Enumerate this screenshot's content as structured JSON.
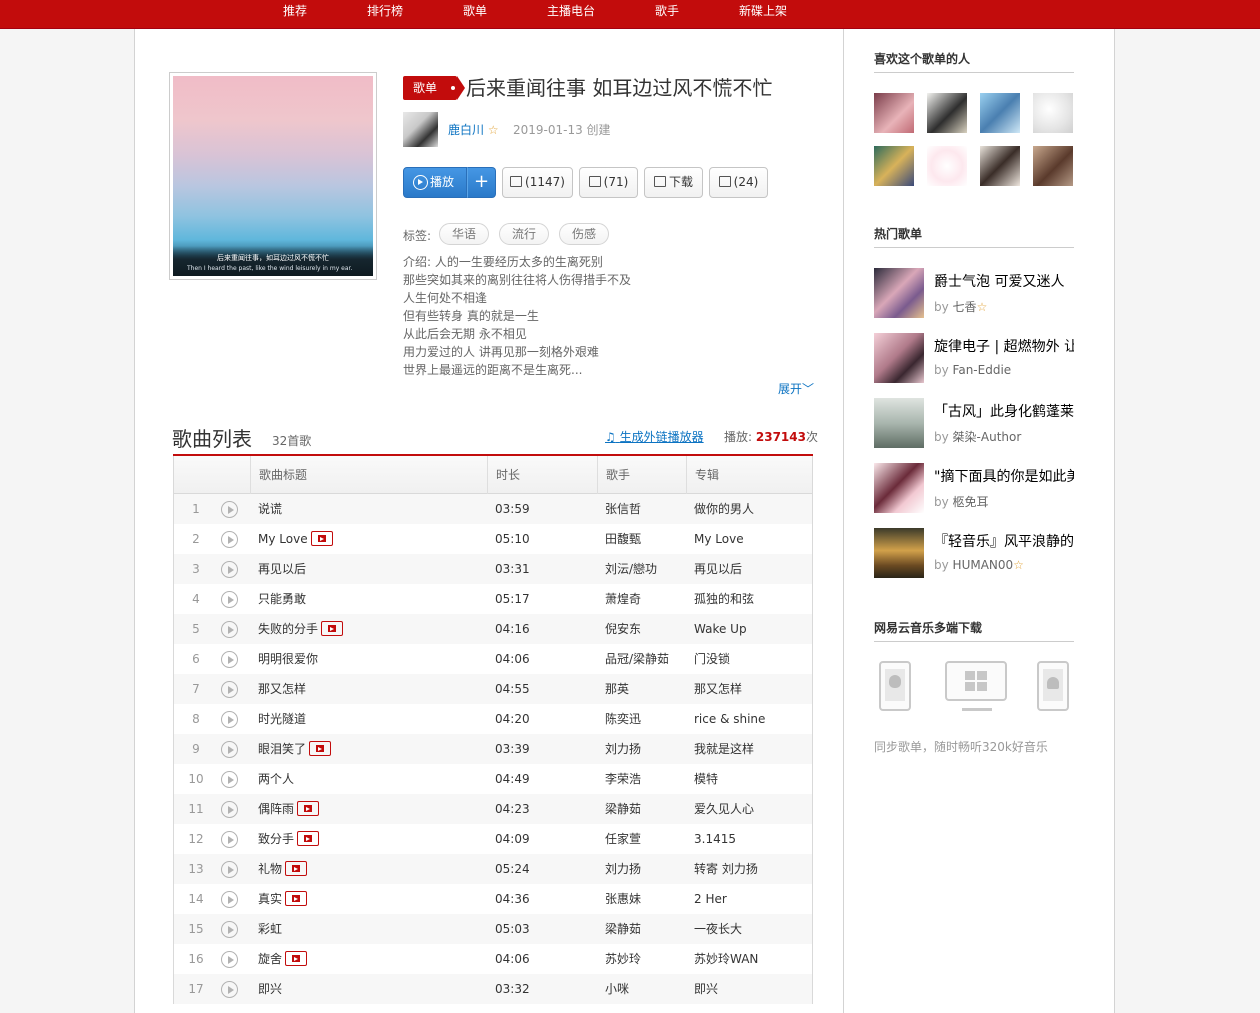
{
  "topnav": [
    "推荐",
    "排行榜",
    "歌单",
    "主播电台",
    "歌手",
    "新碟上架"
  ],
  "playlist": {
    "badge": "歌单",
    "title": "后来重闻往事 如耳边过风不慌不忙",
    "creator": "鹿白川",
    "create_date": "2019-01-13 创建",
    "cover_caption_1": "后来重闻往事，如耳边过风不慌不忙",
    "cover_caption_2": "Then I heard the past, like the wind leisurely in my ear.",
    "buttons": {
      "play": "播放",
      "add": "+",
      "collect": "(1147)",
      "share": "(71)",
      "download": "下载",
      "comment": "(24)"
    },
    "tags_label": "标签:",
    "tags": [
      "华语",
      "流行",
      "伤感"
    ],
    "intro": [
      "介绍:  人的一生要经历太多的生离死别",
      "那些突如其来的离别往往将人伤得措手不及",
      "人生何处不相逢",
      "但有些转身 真的就是一生",
      "从此后会无期 永不相见",
      "用力爱过的人 讲再见那一刻格外艰难",
      "世界上最遥远的距离不是生离死..."
    ],
    "expand_label": "展开"
  },
  "songlist": {
    "title": "歌曲列表",
    "count": "32首歌",
    "gen_link": "生成外链播放器",
    "play_label": "播放:",
    "play_count": "237143",
    "play_suffix": "次",
    "headers": [
      "歌曲标题",
      "时长",
      "歌手",
      "专辑"
    ],
    "rows": [
      {
        "n": "1",
        "title": "说谎",
        "mv": false,
        "dur": "03:59",
        "artist": "张信哲",
        "album": "做你的男人"
      },
      {
        "n": "2",
        "title": "My Love",
        "mv": true,
        "dur": "05:10",
        "artist": "田馥甄",
        "album": "My Love"
      },
      {
        "n": "3",
        "title": "再见以后",
        "mv": false,
        "dur": "03:31",
        "artist": "刘沄/戀功",
        "album": "再见以后"
      },
      {
        "n": "4",
        "title": "只能勇敢",
        "mv": false,
        "dur": "05:17",
        "artist": "萧煌奇",
        "album": "孤独的和弦"
      },
      {
        "n": "5",
        "title": "失败的分手",
        "mv": true,
        "dur": "04:16",
        "artist": "倪安东",
        "album": "Wake Up"
      },
      {
        "n": "6",
        "title": "明明很爱你",
        "mv": false,
        "dur": "04:06",
        "artist": "品冠/梁静茹",
        "album": "门没锁"
      },
      {
        "n": "7",
        "title": "那又怎样",
        "mv": false,
        "dur": "04:55",
        "artist": "那英",
        "album": "那又怎样"
      },
      {
        "n": "8",
        "title": "时光隧道",
        "mv": false,
        "dur": "04:20",
        "artist": "陈奕迅",
        "album": "rice & shine"
      },
      {
        "n": "9",
        "title": "眼泪笑了",
        "mv": true,
        "dur": "03:39",
        "artist": "刘力扬",
        "album": "我就是这样"
      },
      {
        "n": "10",
        "title": "两个人",
        "mv": false,
        "dur": "04:49",
        "artist": "李荣浩",
        "album": "模特"
      },
      {
        "n": "11",
        "title": "偶阵雨",
        "mv": true,
        "dur": "04:23",
        "artist": "梁静茹",
        "album": "爱久见人心"
      },
      {
        "n": "12",
        "title": "致分手",
        "mv": true,
        "dur": "04:09",
        "artist": "任家萱",
        "album": "3.1415"
      },
      {
        "n": "13",
        "title": "礼物",
        "mv": true,
        "dur": "05:24",
        "artist": "刘力扬",
        "album": "转寄 刘力扬"
      },
      {
        "n": "14",
        "title": "真实",
        "mv": true,
        "dur": "04:36",
        "artist": "张惠妹",
        "album": "2 Her"
      },
      {
        "n": "15",
        "title": "彩虹",
        "mv": false,
        "dur": "05:03",
        "artist": "梁静茹",
        "album": "一夜长大"
      },
      {
        "n": "16",
        "title": "旋舍",
        "mv": true,
        "dur": "04:06",
        "artist": "苏妙玲",
        "album": "苏妙玲WAN"
      },
      {
        "n": "17",
        "title": "即兴",
        "mv": false,
        "dur": "03:32",
        "artist": "小咪",
        "album": "即兴"
      }
    ]
  },
  "sidebar": {
    "likers_title": "喜欢这个歌单的人",
    "hot_title": "热门歌单",
    "hot": [
      {
        "title": "爵士气泡 可爱又迷人",
        "by": "by",
        "user": "七香",
        "star": true
      },
      {
        "title": "旋律电子 | 超燃物外 让你心醉",
        "by": "by",
        "user": "Fan-Eddie",
        "star": false
      },
      {
        "title": "「古风」此身化鹤蓬莱",
        "by": "by",
        "user": "桀染-Author",
        "star": false
      },
      {
        "title": "\"摘下面具的你是如此美丽\"",
        "by": "by",
        "user": "柩免耳",
        "star": false
      },
      {
        "title": "『轻音乐』风平浪静的午后",
        "by": "by",
        "user": "HUMAN00",
        "star": true
      }
    ],
    "download_title": "网易云音乐多端下载",
    "download_note": "同步歌单，随时畅听320k好音乐"
  }
}
